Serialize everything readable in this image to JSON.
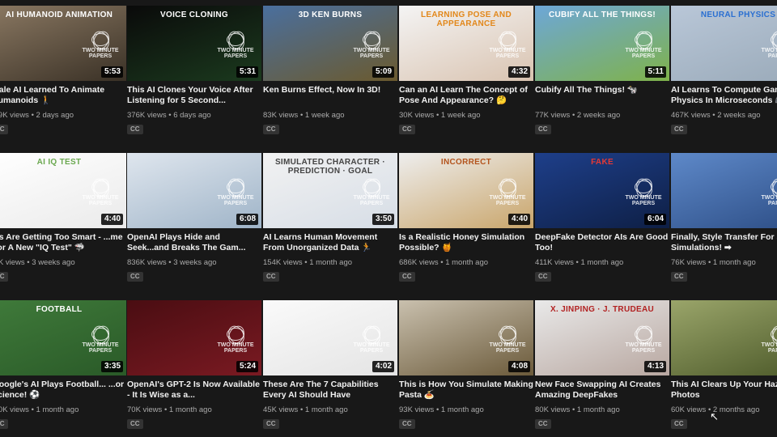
{
  "brand_text": "TWO MINUTE PAPERS",
  "videos": [
    {
      "caption": "AI HUMANOID ANIMATION",
      "title": "...ale AI Learned To Animate Humanoids 🚶",
      "views": "...9K views",
      "age": "2 days ago",
      "duration": "5:53",
      "cc": "CC",
      "bg": [
        "#8a7862",
        "#3a3126"
      ],
      "caption_color": "#ffffff"
    },
    {
      "caption": "VOICE CLONING",
      "title": "This AI Clones Your Voice After Listening for 5 Second...",
      "views": "376K views",
      "age": "6 days ago",
      "duration": "5:31",
      "cc": "CC",
      "bg": [
        "#0a0a0a",
        "#1b3a1e"
      ],
      "caption_color": "#ffffff"
    },
    {
      "caption": "3D KEN BURNS",
      "title": "Ken Burns Effect, Now In 3D!",
      "views": "83K views",
      "age": "1 week ago",
      "duration": "5:09",
      "cc": "CC",
      "bg": [
        "#4a6f9e",
        "#6b5a2e"
      ],
      "caption_color": "#ffffff"
    },
    {
      "caption": "LEARNING POSE AND APPEARANCE",
      "title": "Can an AI Learn The Concept of Pose And Appearance? 🤔",
      "views": "30K views",
      "age": "1 week ago",
      "duration": "4:32",
      "cc": "CC",
      "bg": [
        "#f4f4f4",
        "#d9c3b0"
      ],
      "caption_color": "#e2871a"
    },
    {
      "caption": "CUBIFY ALL THE THINGS!",
      "title": "Cubify All The Things! 🐄",
      "views": "77K views",
      "age": "2 weeks ago",
      "duration": "5:11",
      "cc": "CC",
      "bg": [
        "#6da7d8",
        "#7fb24a"
      ],
      "caption_color": "#ffffff"
    },
    {
      "caption": "NEURAL PHYSICS",
      "title": "AI Learns To Compute Gam... Physics In Microseconds 🎮",
      "views": "467K views",
      "age": "2 weeks ago",
      "duration": "",
      "cc": "CC",
      "bg": [
        "#b9c7d8",
        "#9aaab9"
      ],
      "caption_color": "#2a6fd1"
    },
    {
      "caption": "AI IQ TEST",
      "title": "...s Are Getting Too Smart - ...me For A New \"IQ Test\" 🦈",
      "views": "...K views",
      "age": "3 weeks ago",
      "duration": "4:40",
      "cc": "CC",
      "bg": [
        "#ffffff",
        "#eaeaea"
      ],
      "caption_color": "#6aa84f"
    },
    {
      "caption": "",
      "title": "OpenAI Plays Hide and Seek...and Breaks The Gam...",
      "views": "836K views",
      "age": "3 weeks ago",
      "duration": "6:08",
      "cc": "CC",
      "bg": [
        "#dfe6ee",
        "#9fb4c8"
      ],
      "caption_color": "#ffffff"
    },
    {
      "caption": "Simulated Character · Prediction · Goal",
      "title": "AI Learns Human Movement From Unorganized Data 🏃",
      "views": "154K views",
      "age": "1 month ago",
      "duration": "3:50",
      "cc": "CC",
      "bg": [
        "#f2f2f2",
        "#d6dde6"
      ],
      "caption_color": "#444444"
    },
    {
      "caption": "INCORRECT",
      "title": "Is a Realistic Honey Simulation Possible? 🍯",
      "views": "686K views",
      "age": "1 month ago",
      "duration": "4:40",
      "cc": "CC",
      "bg": [
        "#eeeeee",
        "#c9a56a"
      ],
      "caption_color": "#b3531c"
    },
    {
      "caption": "FAKE",
      "title": "DeepFake Detector AIs Are Good Too!",
      "views": "411K views",
      "age": "1 month ago",
      "duration": "6:04",
      "cc": "CC",
      "bg": [
        "#1e3f8a",
        "#0e1f45"
      ],
      "caption_color": "#e53935"
    },
    {
      "caption": "",
      "title": "Finally, Style Transfer For Smoke Simulations! ➡",
      "views": "76K views",
      "age": "1 month ago",
      "duration": "",
      "cc": "CC",
      "bg": [
        "#5e89c9",
        "#2d4e86"
      ],
      "caption_color": "#ffffff"
    },
    {
      "caption": "FOOTBALL",
      "title": "...oogle's AI Plays Football... ...or Science! ⚽",
      "views": "...0K views",
      "age": "1 month ago",
      "duration": "3:35",
      "cc": "CC",
      "bg": [
        "#3f7a3a",
        "#2a5a28"
      ],
      "caption_color": "#ffffff"
    },
    {
      "caption": "",
      "title": "OpenAI's GPT-2 Is Now Available - It Is Wise as a...",
      "views": "70K views",
      "age": "1 month ago",
      "duration": "5:24",
      "cc": "CC",
      "bg": [
        "#4a0d12",
        "#7a1a22"
      ],
      "caption_color": "#ffffff"
    },
    {
      "caption": "",
      "title": "These Are The 7 Capabilities Every AI Should Have",
      "views": "45K views",
      "age": "1 month ago",
      "duration": "4:02",
      "cc": "CC",
      "bg": [
        "#fafafa",
        "#e4e4e4"
      ],
      "caption_color": "#333333"
    },
    {
      "caption": "",
      "title": "This is How You Simulate Making Pasta 🍝",
      "views": "93K views",
      "age": "1 month ago",
      "duration": "4:08",
      "cc": "CC",
      "bg": [
        "#c9c0ae",
        "#6b5a3a"
      ],
      "caption_color": "#ffffff"
    },
    {
      "caption": "X. JINPING · J. TRUDEAU",
      "title": "New Face Swapping AI Creates Amazing DeepFakes",
      "views": "80K views",
      "age": "1 month ago",
      "duration": "4:13",
      "cc": "CC",
      "bg": [
        "#e9e9e9",
        "#b8a7a0"
      ],
      "caption_color": "#b22222"
    },
    {
      "caption": "",
      "title": "This AI Clears Up Your Haz... Photos",
      "views": "60K views",
      "age": "2 months ago",
      "duration": "",
      "cc": "CC",
      "bg": [
        "#9aa56a",
        "#4d5a2a"
      ],
      "caption_color": "#ffffff"
    }
  ]
}
